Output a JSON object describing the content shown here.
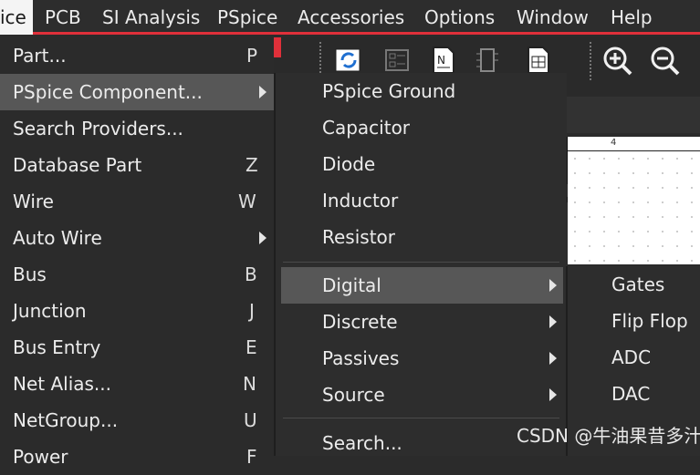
{
  "menubar": {
    "items": [
      {
        "label": "ice"
      },
      {
        "label": "PCB"
      },
      {
        "label": "SI Analysis"
      },
      {
        "label": "PSpice"
      },
      {
        "label": "Accessories"
      },
      {
        "label": "Options"
      },
      {
        "label": "Window"
      },
      {
        "label": "Help"
      }
    ]
  },
  "place_menu": {
    "items": [
      {
        "label": "Part...",
        "shortcut": "P"
      },
      {
        "label": "PSpice Component...",
        "shortcut": ""
      },
      {
        "label": "Search Providers...",
        "shortcut": ""
      },
      {
        "label": "Database Part",
        "shortcut": "Z"
      },
      {
        "label": "Wire",
        "shortcut": "W"
      },
      {
        "label": "Auto Wire",
        "shortcut": ""
      },
      {
        "label": "Bus",
        "shortcut": "B"
      },
      {
        "label": "Junction",
        "shortcut": "J"
      },
      {
        "label": "Bus Entry",
        "shortcut": "E"
      },
      {
        "label": "Net Alias...",
        "shortcut": "N"
      },
      {
        "label": "NetGroup...",
        "shortcut": "U"
      },
      {
        "label": "Power",
        "shortcut": "F"
      }
    ]
  },
  "pspice_component_menu": {
    "items": [
      {
        "label": "PSpice Ground"
      },
      {
        "label": "Capacitor"
      },
      {
        "label": "Diode"
      },
      {
        "label": "Inductor"
      },
      {
        "label": "Resistor"
      },
      {
        "label": "Digital"
      },
      {
        "label": "Discrete"
      },
      {
        "label": "Passives"
      },
      {
        "label": "Source"
      },
      {
        "label": "Search..."
      }
    ]
  },
  "digital_menu": {
    "items": [
      {
        "label": "Gates"
      },
      {
        "label": "Flip Flop"
      },
      {
        "label": "ADC"
      },
      {
        "label": "DAC"
      }
    ]
  },
  "canvas": {
    "ruler_label": "4"
  },
  "watermark": "CSDN @牛油果昔多汁",
  "colors": {
    "accent": "#e0303a",
    "highlight": "#575757",
    "menu_bg": "#2b2b2b"
  }
}
